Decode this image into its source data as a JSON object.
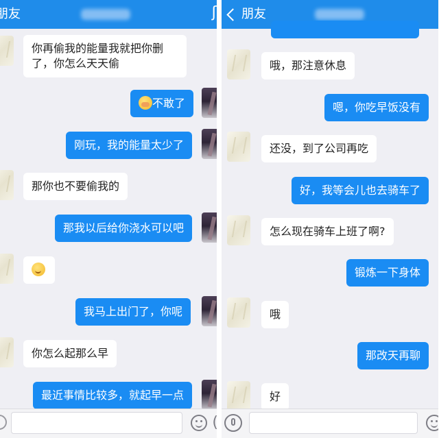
{
  "left_panel": {
    "header": {
      "back_label": "朋友",
      "edge_glyph": "ʃ"
    },
    "messages": [
      {
        "id": "l1",
        "side": "in",
        "text": "你再偷我的能量我就把你删了，你怎么天天偷"
      },
      {
        "id": "l2",
        "side": "out",
        "emoji": "hand-emoji",
        "text": "不敢了"
      },
      {
        "id": "l3",
        "side": "out",
        "text": "刚玩，我的能量太少了"
      },
      {
        "id": "l4",
        "side": "in",
        "text": "那你也不要偷我的"
      },
      {
        "id": "l5",
        "side": "out",
        "text": "那我以后给你浇水可以吧"
      },
      {
        "id": "l6",
        "side": "in",
        "emoji": "smirk-emoji",
        "text": ""
      },
      {
        "id": "l7",
        "side": "out",
        "text": "我马上出门了，你呢"
      },
      {
        "id": "l8",
        "side": "in",
        "text": "你怎么起那么早"
      },
      {
        "id": "l9",
        "side": "out",
        "text": "最近事情比较多，就起早一点"
      }
    ],
    "input_bar": {
      "face_icon": "emoji-face-icon",
      "edge_glyph": "("
    }
  },
  "right_panel": {
    "header": {
      "back_label": "朋友"
    },
    "messages": [
      {
        "id": "r1",
        "side": "in",
        "text": "哦，那注意休息"
      },
      {
        "id": "r2",
        "side": "out",
        "text": "嗯，你吃早饭没有"
      },
      {
        "id": "r3",
        "side": "in",
        "text": "还没，到了公司再吃"
      },
      {
        "id": "r4",
        "side": "out",
        "text": "好，我等会儿也去骑车了"
      },
      {
        "id": "r5",
        "side": "in",
        "text": "怎么现在骑车上班了啊?"
      },
      {
        "id": "r6",
        "side": "out",
        "text": "锻炼一下身体"
      },
      {
        "id": "r7",
        "side": "in",
        "text": "哦"
      },
      {
        "id": "r8",
        "side": "out",
        "text": "那改天再聊"
      },
      {
        "id": "r9",
        "side": "in",
        "text": "好"
      }
    ],
    "input_bar": {
      "voice_icon": "voice-icon",
      "face_icon": "emoji-face-icon"
    }
  },
  "colors": {
    "header_blue": "#1f8cea",
    "outgoing_bubble": "#1a8cf3",
    "incoming_bubble": "#ffffff",
    "chat_background": "#efeff4"
  }
}
